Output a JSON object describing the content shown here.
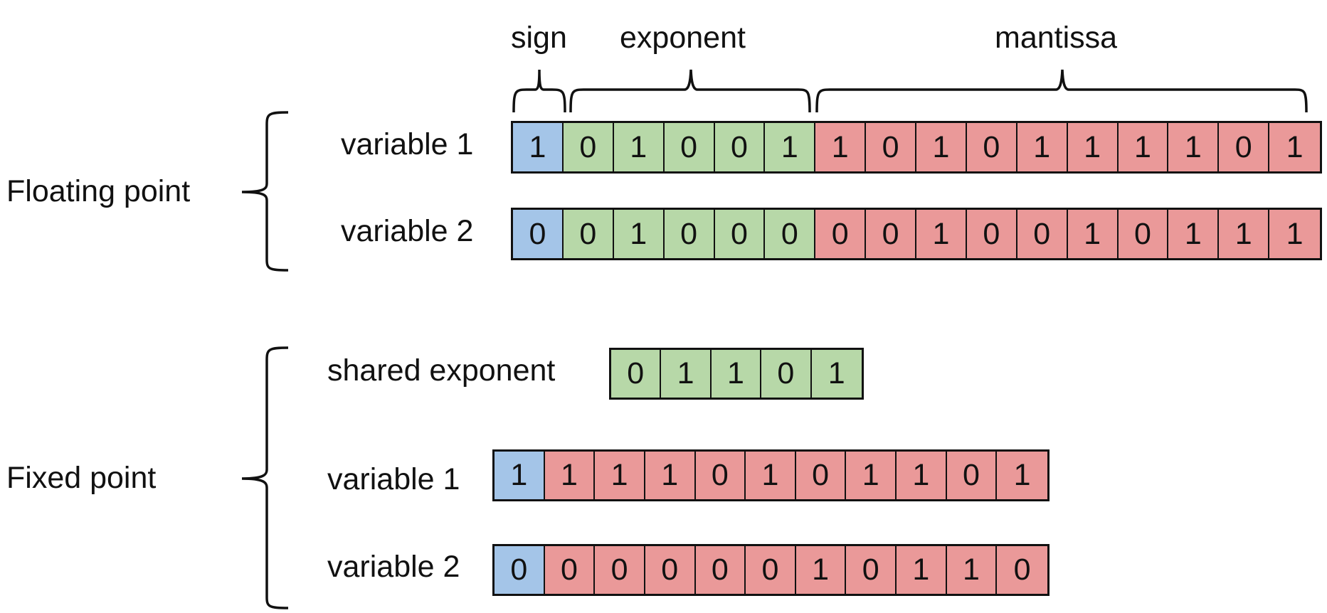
{
  "floating_point": {
    "label": "Floating point",
    "field_labels": {
      "sign": "sign",
      "exponent": "exponent",
      "mantissa": "mantissa"
    },
    "variables": [
      {
        "label": "variable 1",
        "sign": [
          "1"
        ],
        "exponent": [
          "0",
          "1",
          "0",
          "0",
          "1"
        ],
        "mantissa": [
          "1",
          "0",
          "1",
          "0",
          "1",
          "1",
          "1",
          "1",
          "0",
          "1"
        ]
      },
      {
        "label": "variable 2",
        "sign": [
          "0"
        ],
        "exponent": [
          "0",
          "1",
          "0",
          "0",
          "0"
        ],
        "mantissa": [
          "0",
          "0",
          "1",
          "0",
          "0",
          "1",
          "0",
          "1",
          "1",
          "1"
        ]
      }
    ]
  },
  "fixed_point": {
    "label": "Fixed point",
    "shared_exponent": {
      "label": "shared exponent",
      "bits": [
        "0",
        "1",
        "1",
        "0",
        "1"
      ]
    },
    "variables": [
      {
        "label": "variable 1",
        "sign": [
          "1"
        ],
        "mantissa": [
          "1",
          "1",
          "1",
          "0",
          "1",
          "0",
          "1",
          "1",
          "0",
          "1"
        ]
      },
      {
        "label": "variable 2",
        "sign": [
          "0"
        ],
        "mantissa": [
          "0",
          "0",
          "0",
          "0",
          "0",
          "1",
          "0",
          "1",
          "1",
          "0"
        ]
      }
    ]
  },
  "colors": {
    "sign": "#a4c5e8",
    "exponent": "#b7d8a8",
    "mantissa": "#ea9999"
  }
}
